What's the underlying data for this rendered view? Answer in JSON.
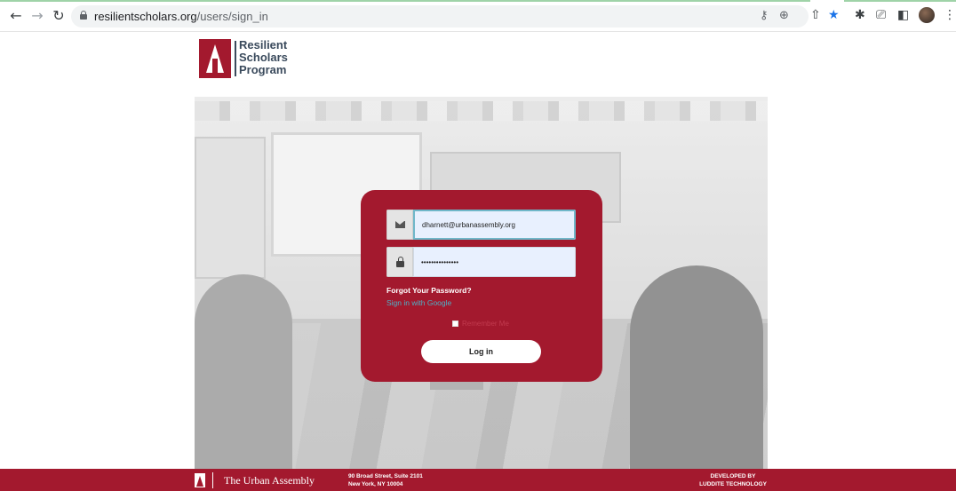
{
  "browser": {
    "url_host": "resilientscholars.org",
    "url_path": "/users/sign_in",
    "icons": [
      "back-arrow-icon",
      "forward-arrow-icon",
      "reload-icon",
      "lock-icon",
      "key-icon",
      "zoom-icon",
      "share-icon",
      "star-icon",
      "extensions-icon",
      "cast-icon",
      "sidepanel-icon",
      "avatar",
      "menu-icon"
    ]
  },
  "logo": {
    "line1": "Resilient",
    "line2": "Scholars",
    "line3": "Program"
  },
  "login": {
    "email_value": "dharnett@urbanassembly.org",
    "password_value": "•••••••••••••••",
    "forgot_label": "Forgot Your Password?",
    "google_label": "Sign in with Google",
    "remember_label": "Remember Me",
    "login_label": "Log in"
  },
  "footer": {
    "org_name": "The Urban Assembly",
    "address_line1": "90 Broad Street, Suite 2101",
    "address_line2": "New York, NY 10004",
    "dev_line1": "DEVELOPED BY",
    "dev_line2": "LUDDITE TECHNOLOGY"
  },
  "colors": {
    "brand": "#a3192e",
    "link": "#4fb0c6"
  }
}
